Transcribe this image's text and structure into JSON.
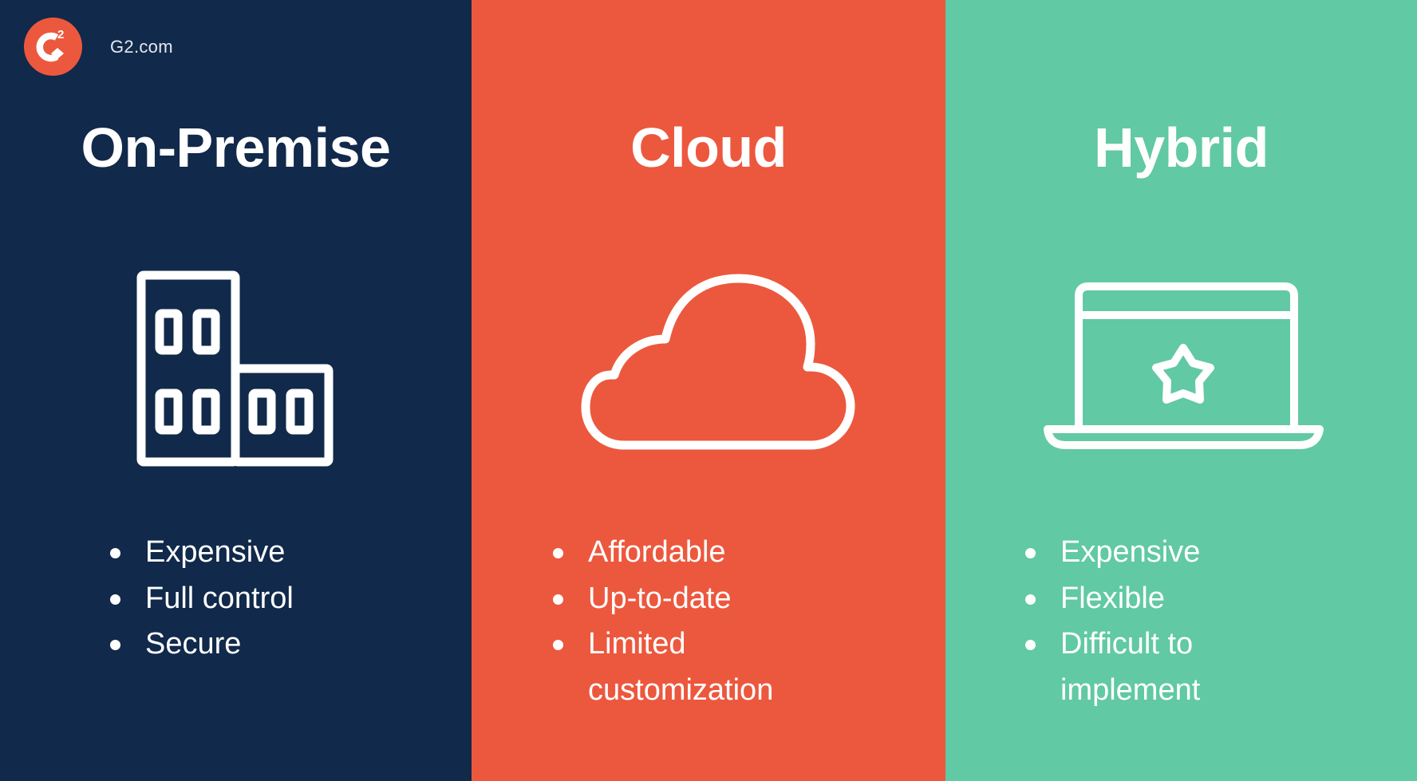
{
  "brand": {
    "logo_icon": "g2-logo-icon",
    "logo_text": "G",
    "logo_superscript": "2",
    "site": "G2.com"
  },
  "colors": {
    "on_premise_bg": "#11294a",
    "cloud_bg": "#ec583e",
    "hybrid_bg": "#61c9a4",
    "text": "#ffffff",
    "brand_accent": "#ec583e"
  },
  "panels": [
    {
      "id": "on-premise",
      "title": "On-Premise",
      "icon": "office-building-icon",
      "features": [
        "Expensive",
        "Full control",
        "Secure"
      ]
    },
    {
      "id": "cloud",
      "title": "Cloud",
      "icon": "cloud-icon",
      "features": [
        "Affordable",
        "Up-to-date",
        "Limited customization"
      ]
    },
    {
      "id": "hybrid",
      "title": "Hybrid",
      "icon": "laptop-star-icon",
      "features": [
        "Expensive",
        "Flexible",
        "Difficult to implement"
      ]
    }
  ]
}
